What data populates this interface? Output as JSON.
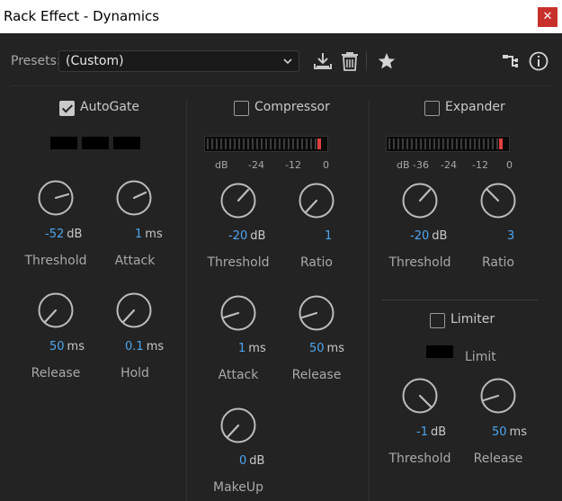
{
  "window": {
    "title": "Rack Effect - Dynamics",
    "close_glyph": "✕"
  },
  "toolbar": {
    "presets_label": "Presets:",
    "presets_value": "(Custom)",
    "icons": [
      "save-preset-icon",
      "delete-preset-icon",
      "favorite-star-icon",
      "routing-icon",
      "info-icon"
    ]
  },
  "autogate": {
    "label": "AutoGate",
    "enabled": true,
    "threshold": {
      "value": "-52",
      "unit": "dB",
      "label": "Threshold"
    },
    "attack": {
      "value": "1",
      "unit": "ms",
      "label": "Attack"
    },
    "release": {
      "value": "50",
      "unit": "ms",
      "label": "Release"
    },
    "hold": {
      "value": "0.1",
      "unit": "ms",
      "label": "Hold"
    }
  },
  "compressor": {
    "label": "Compressor",
    "enabled": false,
    "scale": [
      "dB",
      "-24",
      "-12",
      "0"
    ],
    "threshold": {
      "value": "-20",
      "unit": "dB",
      "label": "Threshold"
    },
    "ratio": {
      "value": "1",
      "label": "Ratio"
    },
    "attack": {
      "value": "1",
      "unit": "ms",
      "label": "Attack"
    },
    "release": {
      "value": "50",
      "unit": "ms",
      "label": "Release"
    },
    "makeup": {
      "value": "0",
      "unit": "dB",
      "label": "MakeUp"
    }
  },
  "expander": {
    "label": "Expander",
    "enabled": false,
    "scale": [
      "dB",
      "-36",
      "-24",
      "-12",
      "0"
    ],
    "threshold": {
      "value": "-20",
      "unit": "dB",
      "label": "Threshold"
    },
    "ratio": {
      "value": "3",
      "label": "Ratio"
    }
  },
  "limiter": {
    "label": "Limiter",
    "enabled": false,
    "limit_label": "Limit",
    "threshold": {
      "value": "-1",
      "unit": "dB",
      "label": "Threshold"
    },
    "release": {
      "value": "50",
      "unit": "ms",
      "label": "Release"
    }
  },
  "colors": {
    "accent_value": "#4ea6ef",
    "peak": "#e04040",
    "close": "#c8302c"
  }
}
